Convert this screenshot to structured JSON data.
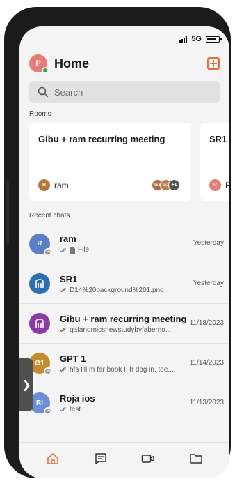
{
  "status_bar": {
    "network": "5G"
  },
  "header": {
    "title": "Home",
    "avatar_initial": "P"
  },
  "search": {
    "placeholder": "Search"
  },
  "rooms": {
    "label": "Rooms",
    "cards": [
      {
        "title": "Gibu + ram recurring meeting",
        "owner": "ram",
        "owner_initial": "R",
        "members": [
          "G3",
          "G1"
        ],
        "more": "+1"
      },
      {
        "title": "SR1",
        "owner": "P",
        "owner_initial": "P"
      }
    ]
  },
  "recent": {
    "label": "Recent chats",
    "chats": [
      {
        "name": "ram",
        "preview": "File",
        "time": "Yesterday",
        "initial": "R",
        "avatar_color": "#5b7fc4"
      },
      {
        "name": "SR1",
        "preview": "D14%20background%201.png",
        "time": "Yesterday",
        "initial": "",
        "avatar_color": "#2f6fb1"
      },
      {
        "name": "Gibu + ram recurring meeting",
        "preview": "qafanomicsnewstudybyfaberno...",
        "time": "11/18/2023",
        "initial": "",
        "avatar_color": "#8b3aa6"
      },
      {
        "name": "GPT 1",
        "preview": "hfs I'll m far book I. h dog in. tee...",
        "time": "11/14/2023",
        "initial": "G1",
        "avatar_color": "#c58b2c"
      },
      {
        "name": "Roja ios",
        "preview": "test",
        "time": "11/13/2023",
        "initial": "RI",
        "avatar_color": "#6a8fd6"
      }
    ]
  },
  "colors": {
    "accent": "#e86a3c",
    "online": "#27a844"
  },
  "nav": [
    "home-icon",
    "chat-icon",
    "video-icon",
    "folder-icon"
  ]
}
